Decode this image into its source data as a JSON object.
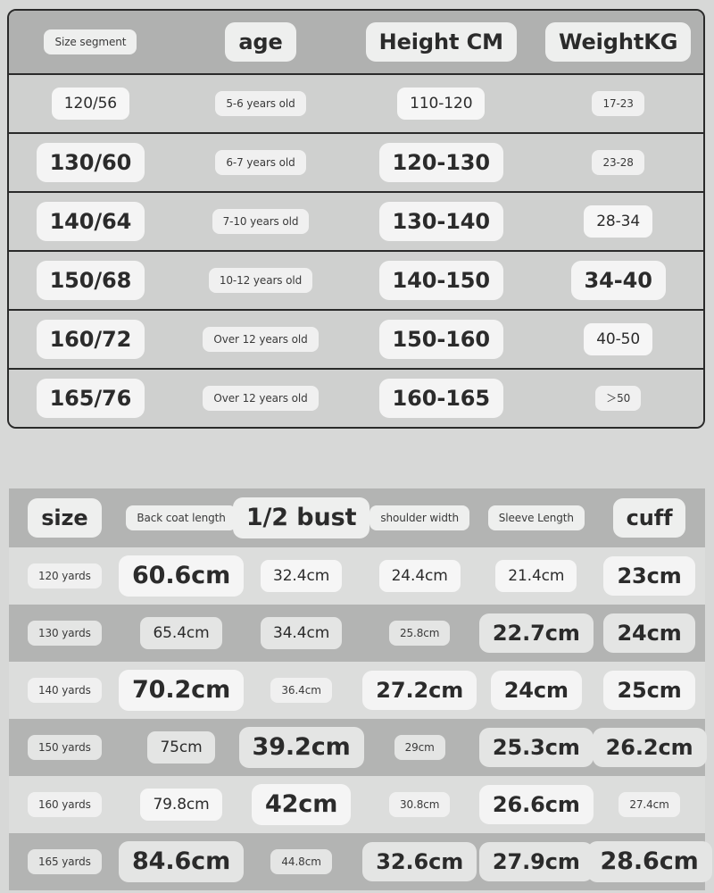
{
  "size_table": {
    "columns": [
      "Size segment",
      "age",
      "Height CM",
      "WeightKG"
    ],
    "column_styles": [
      "s",
      "l",
      "m",
      "m"
    ],
    "rows": [
      {
        "cells": [
          "120/56",
          "5-6 years old",
          "110-120",
          "17-23"
        ],
        "styles": [
          "m",
          "s",
          "m",
          "s"
        ]
      },
      {
        "cells": [
          "130/60",
          "6-7 years old",
          "120-130",
          "23-28"
        ],
        "styles": [
          "l",
          "s",
          "m",
          "s"
        ]
      },
      {
        "cells": [
          "140/64",
          "7-10 years old",
          "130-140",
          "28-34"
        ],
        "styles": [
          "l",
          "s",
          "m",
          "s"
        ]
      },
      {
        "cells": [
          "150/68",
          "10-12 years old",
          "140-150",
          "34-40"
        ],
        "styles": [
          "l",
          "s",
          "m",
          "m"
        ]
      },
      {
        "cells": [
          "160/72",
          "Over 12 years old",
          "150-160",
          "40-50"
        ],
        "styles": [
          "l",
          "s",
          "m",
          "m"
        ]
      },
      {
        "cells": [
          "165/76",
          "Over 12 years old",
          "160-165",
          "＞50"
        ],
        "styles": [
          "l",
          "s",
          "m",
          "s"
        ]
      }
    ]
  },
  "measurement_table": {
    "columns": [
      "size",
      "Back coat length",
      "1/2 bust",
      "shoulder width",
      "Sleeve Length",
      "cuff"
    ],
    "column_styles": [
      "l",
      "s",
      "xl",
      "s",
      "s",
      "l"
    ],
    "rows": [
      {
        "cells": [
          "120 yards",
          "60.6cm",
          "32.4cm",
          "24.4cm",
          "21.4cm",
          "23cm"
        ],
        "styles": [
          "s",
          "xl",
          "m",
          "m",
          "m",
          "l"
        ]
      },
      {
        "cells": [
          "130 yards",
          "65.4cm",
          "34.4cm",
          "25.8cm",
          "22.7cm",
          "24cm"
        ],
        "styles": [
          "s",
          "m",
          "m",
          "s",
          "l",
          "l"
        ]
      },
      {
        "cells": [
          "140 yards",
          "70.2cm",
          "36.4cm",
          "27.2cm",
          "24cm",
          "25cm"
        ],
        "styles": [
          "s",
          "xl",
          "s",
          "l",
          "l",
          "l"
        ]
      },
      {
        "cells": [
          "150 yards",
          "75cm",
          "39.2cm",
          "29cm",
          "25.3cm",
          "26.2cm"
        ],
        "styles": [
          "s",
          "m",
          "xl",
          "s",
          "l",
          "l"
        ]
      },
      {
        "cells": [
          "160 yards",
          "79.8cm",
          "42cm",
          "30.8cm",
          "26.6cm",
          "27.4cm"
        ],
        "styles": [
          "s",
          "m",
          "xl",
          "s",
          "l",
          "s"
        ]
      },
      {
        "cells": [
          "165 yards",
          "84.6cm",
          "44.8cm",
          "32.6cm",
          "27.9cm",
          "28.6cm"
        ],
        "styles": [
          "s",
          "xl",
          "s",
          "l",
          "l",
          "xl"
        ]
      }
    ]
  },
  "colors": {
    "page_background": "#d7d8d7",
    "table1_border": "#2a2a2a",
    "table1_header_bg": "#b0b1b0",
    "table1_row_bg": "#cfd0cf",
    "table2_header_bg": "#b3b4b3",
    "table2_row_odd_bg": "#dcdddc",
    "table2_row_even_bg": "#b3b4b3",
    "pill_bg": "#f5f5f5",
    "text": "#2b2b2b"
  }
}
